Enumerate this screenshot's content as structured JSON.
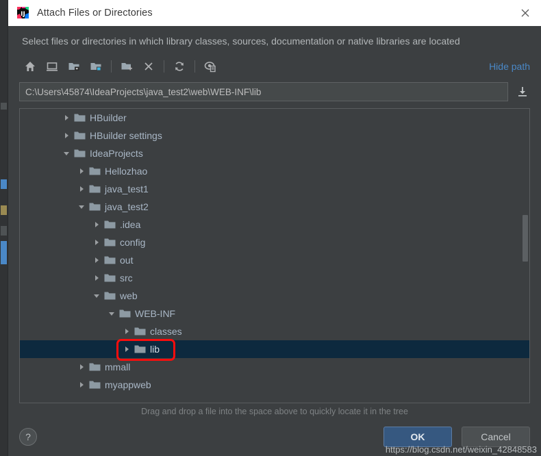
{
  "window": {
    "title": "Attach Files or Directories",
    "app_icon": "intellij-idea-icon",
    "close_label": "×"
  },
  "description": "Select files or directories in which library classes, sources, documentation or native libraries are located",
  "toolbar": {
    "hide_path_label": "Hide path",
    "buttons": [
      {
        "name": "home-icon",
        "tooltip": "Home"
      },
      {
        "name": "desktop-icon",
        "tooltip": "Desktop"
      },
      {
        "name": "project-folder-icon",
        "tooltip": "Project"
      },
      {
        "name": "module-folder-icon",
        "tooltip": "Module"
      },
      {
        "name": "new-folder-icon",
        "tooltip": "New Folder"
      },
      {
        "name": "delete-icon",
        "tooltip": "Delete"
      },
      {
        "name": "refresh-icon",
        "tooltip": "Refresh"
      },
      {
        "name": "show-hidden-files-icon",
        "tooltip": "Show Hidden Files"
      }
    ]
  },
  "path": {
    "value": "C:\\Users\\45874\\IdeaProjects\\java_test2\\web\\WEB-INF\\lib",
    "placeholder": "",
    "download_icon": "download-icon"
  },
  "tree": {
    "rows": [
      {
        "label": "HBuilder",
        "depth": 1,
        "state": "collapsed",
        "selected": false
      },
      {
        "label": "HBuilder settings",
        "depth": 1,
        "state": "collapsed",
        "selected": false
      },
      {
        "label": "IdeaProjects",
        "depth": 1,
        "state": "expanded",
        "selected": false
      },
      {
        "label": "Hellozhao",
        "depth": 2,
        "state": "collapsed",
        "selected": false
      },
      {
        "label": "java_test1",
        "depth": 2,
        "state": "collapsed",
        "selected": false
      },
      {
        "label": "java_test2",
        "depth": 2,
        "state": "expanded",
        "selected": false
      },
      {
        "label": ".idea",
        "depth": 3,
        "state": "collapsed",
        "selected": false
      },
      {
        "label": "config",
        "depth": 3,
        "state": "collapsed",
        "selected": false
      },
      {
        "label": "out",
        "depth": 3,
        "state": "collapsed",
        "selected": false
      },
      {
        "label": "src",
        "depth": 3,
        "state": "collapsed",
        "selected": false
      },
      {
        "label": "web",
        "depth": 3,
        "state": "expanded",
        "selected": false
      },
      {
        "label": "WEB-INF",
        "depth": 4,
        "state": "expanded",
        "selected": false
      },
      {
        "label": "classes",
        "depth": 5,
        "state": "collapsed",
        "selected": false
      },
      {
        "label": "lib",
        "depth": 5,
        "state": "collapsed",
        "selected": true
      },
      {
        "label": "mmall",
        "depth": 2,
        "state": "collapsed",
        "selected": false
      },
      {
        "label": "myappweb",
        "depth": 2,
        "state": "collapsed",
        "selected": false
      }
    ],
    "annotated_row_label": "lib"
  },
  "hint": "Drag and drop a file into the space above to quickly locate it in the tree",
  "footer": {
    "help_label": "?",
    "ok_label": "OK",
    "cancel_label": "Cancel"
  },
  "watermark": "https://blog.csdn.net/weixin_42848583",
  "colors": {
    "accent": "#365880",
    "link": "#4a88c7",
    "selection": "#0d293e",
    "annotation": "#fb0d0d",
    "window_bg": "#3c3f41",
    "text": "#a9b7c6"
  }
}
